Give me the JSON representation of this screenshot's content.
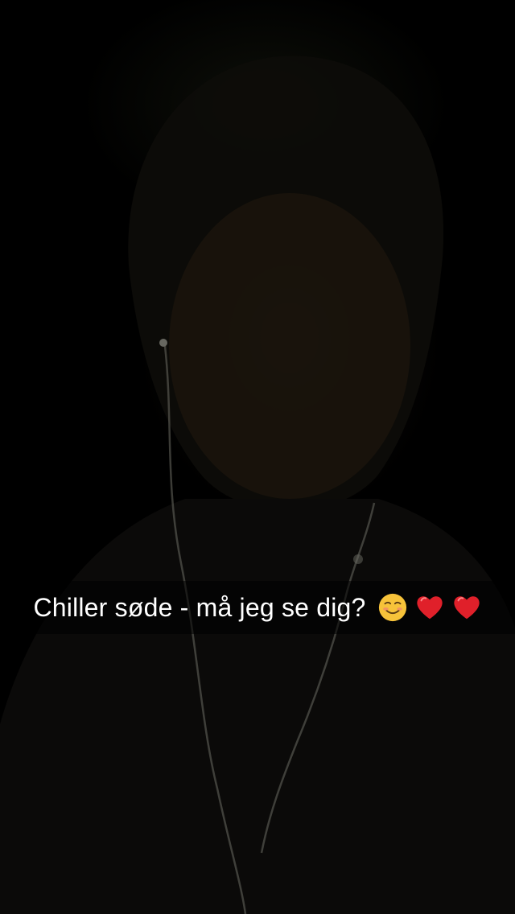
{
  "snap": {
    "caption": {
      "text": "Chiller søde - må jeg se dig?",
      "emojis": [
        "smiling-face-icon",
        "red-heart-icon",
        "red-heart-icon"
      ]
    }
  },
  "colors": {
    "background": "#000000",
    "caption_text": "#ffffff",
    "caption_bar": "rgba(0,0,0,0.55)",
    "heart": "#e0202a",
    "smiley": "#f7c33a"
  }
}
